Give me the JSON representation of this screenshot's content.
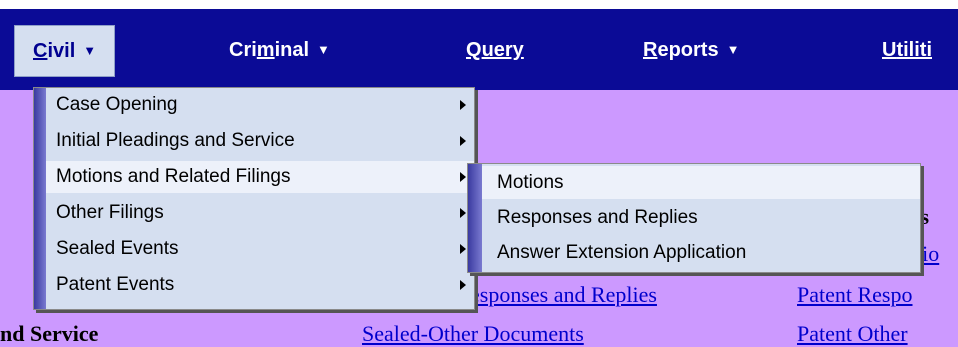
{
  "nav": {
    "items": [
      {
        "label": "Civil",
        "access": "C",
        "rest": "ivil",
        "has_menu": true
      },
      {
        "label": "Criminal",
        "before": "Cri",
        "access": "m",
        "rest": "inal",
        "has_menu": true
      },
      {
        "label": "Query",
        "access": "Q",
        "rest": "uery",
        "has_menu": false
      },
      {
        "label": "Reports",
        "access": "R",
        "rest": "eports",
        "has_menu": true
      },
      {
        "label": "Utilities",
        "access": "U",
        "rest": "tiliti",
        "has_menu": false
      }
    ],
    "caret": "▼"
  },
  "civil_menu": {
    "items": [
      "Case Opening",
      "Initial Pleadings and Service",
      "Motions and Related Filings",
      "Other Filings",
      "Sealed Events",
      "Patent Events"
    ],
    "highlighted": "Motions and Related Filings"
  },
  "motions_submenu": {
    "items": [
      "Motions",
      "Responses and Replies",
      "Answer Extension Application"
    ],
    "highlighted": "Motions"
  },
  "background": {
    "heading_left": "nd Service",
    "heading_right": "nts",
    "link_right_top": "otio",
    "link_responses": "esponses and Replies",
    "link_sealed": "Sealed-Other Documents",
    "link_patent_resp": "Patent Respo",
    "link_patent_other": "Patent Other"
  },
  "colors": {
    "navbar": "#0b0b96",
    "page_bg": "#cc99ff",
    "menu_bg": "#d5dff0",
    "link": "#0000cc"
  }
}
